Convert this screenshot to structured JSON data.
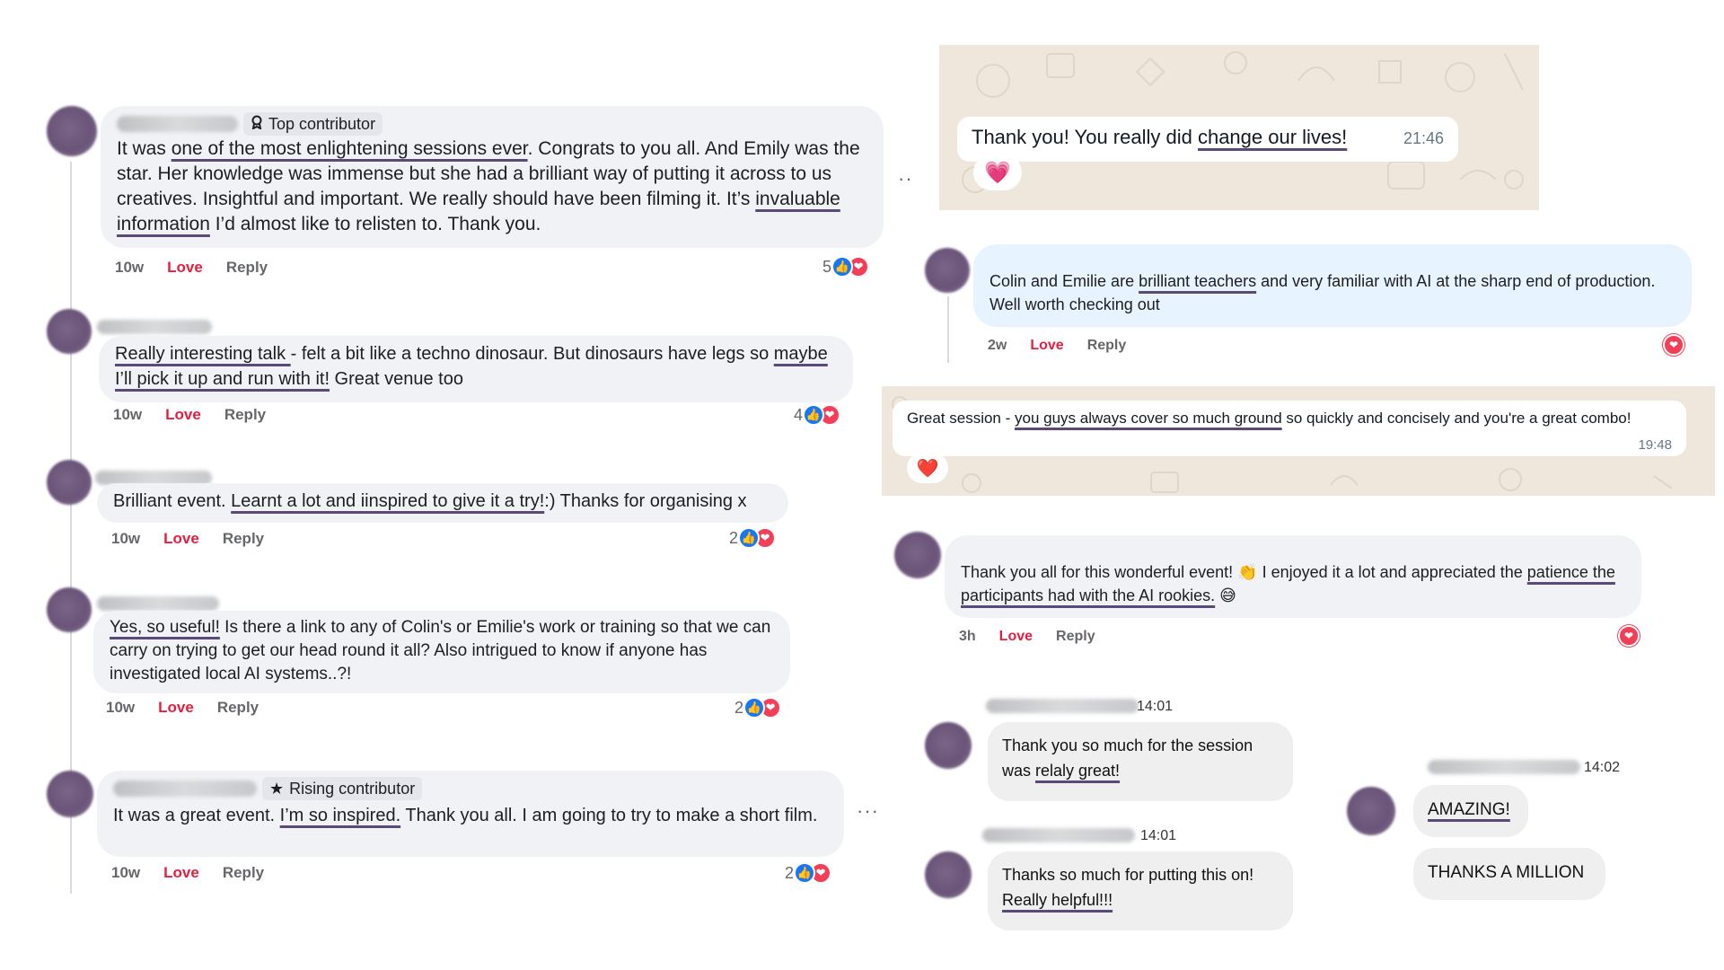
{
  "left_comments": [
    {
      "badge": "Top contributor",
      "text_parts": [
        "It was ",
        "one of the most enlightening sessions ever",
        ". Congrats to you all. And Emily was the star. Her knowledge was immense but she had a brilliant way of putting it across to us creatives. Insightful and important. We really should have been filming it. It’s ",
        "invaluable information",
        " I’d almost like to relisten to. Thank you."
      ],
      "time": "10w",
      "love": "Love",
      "reply": "Reply",
      "count": "5"
    },
    {
      "text_parts": [
        "Really interesting talk ",
        "- felt a bit like a techno dinosaur. But dinosaurs have legs so ",
        "maybe I’ll pick it up and run with it!",
        " Great venue too"
      ],
      "time": "10w",
      "love": "Love",
      "reply": "Reply",
      "count": "4"
    },
    {
      "text_parts": [
        "Brilliant event. ",
        "Learnt a lot and iinspired to give it a try!",
        ":) Thanks for organising x"
      ],
      "time": "10w",
      "love": "Love",
      "reply": "Reply",
      "count": "2"
    },
    {
      "text_parts": [
        "Yes, so useful!",
        " Is there a link to any of Colin's or Emilie's work or training so that we can carry on trying to get our head round it all? Also intrigued to know if anyone has investigated local AI systems..?!"
      ],
      "time": "10w",
      "love": "Love",
      "reply": "Reply",
      "count": "2"
    },
    {
      "badge": "Rising contributor",
      "text_parts": [
        "It was a great event. ",
        "I’m so inspired.",
        " Thank you all. I am going to try to make a short film."
      ],
      "time": "10w",
      "love": "Love",
      "reply": "Reply",
      "count": "2"
    }
  ],
  "wa_top": {
    "text_parts": [
      "Thank you! You really did ",
      "change our lives!"
    ],
    "time": "21:46",
    "reaction": "💗"
  },
  "right_comment_1": {
    "text_parts": [
      "Colin and Emilie are ",
      "brilliant teachers",
      " and very familiar with AI at the sharp end of production. Well worth checking out"
    ],
    "time": "2w",
    "love": "Love",
    "reply": "Reply"
  },
  "wa_mid": {
    "text_parts": [
      "Great session - ",
      "you guys always cover so much ground",
      " so quickly and concisely and you're a great combo!"
    ],
    "time": "19:48",
    "reaction": "❤️"
  },
  "right_comment_2": {
    "text_parts": [
      "Thank you all for this wonderful event! 👏 I enjoyed it a lot and appreciated the ",
      "patience the participants had with the AI rookies.",
      " 😅"
    ],
    "time": "3h",
    "love": "Love",
    "reply": "Reply"
  },
  "ig_a": {
    "time1": "14:01",
    "msg1_parts": [
      "Thank you so much for the session was ",
      "relaly great!"
    ],
    "time2": "14:01",
    "msg2_parts": [
      "Thanks so much for putting this on! ",
      "Really helpful!!!"
    ]
  },
  "ig_b": {
    "time": "14:02",
    "msg1": "AMAZING!",
    "msg2": "THANKS A MILLION"
  },
  "icons": {
    "badge_top": "award-icon",
    "badge_rising": "star-icon",
    "like": "thumbs-up-icon",
    "heart": "heart-icon",
    "more": "more-dots-icon"
  },
  "colors": {
    "love": "#e41e3f",
    "like": "#1877f2",
    "heart": "#f33e58",
    "underline": "#5b4a78",
    "fb_bubble": "#f0f2f5",
    "wa_bg": "#efe7dc",
    "blue_bubble": "#e7f3ff"
  }
}
